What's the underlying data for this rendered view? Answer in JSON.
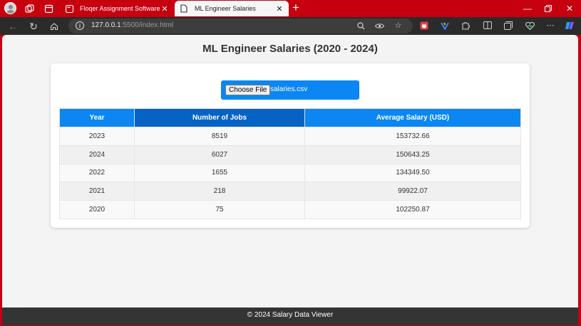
{
  "browser": {
    "tabs": [
      {
        "title": "Floqer Assignment Software Deve"
      },
      {
        "title": "ML Engineer Salaries"
      }
    ],
    "url_host": "127.0.0.1",
    "url_rest": ":5500/index.html"
  },
  "page": {
    "title": "ML Engineer Salaries (2020 - 2024)",
    "file_button_label": "Choose File",
    "file_name": "salaries.csv",
    "table": {
      "headers": [
        "Year",
        "Number of Jobs",
        "Average Salary (USD)"
      ],
      "rows": [
        [
          "2023",
          "8519",
          "153732.66"
        ],
        [
          "2024",
          "6027",
          "150643.25"
        ],
        [
          "2022",
          "1655",
          "134349.50"
        ],
        [
          "2021",
          "218",
          "99922.07"
        ],
        [
          "2020",
          "75",
          "102250.87"
        ]
      ]
    },
    "footer": "© 2024 Salary Data Viewer"
  },
  "colors": {
    "browser_frame": "#c7000f",
    "accent": "#0b86f3",
    "header_hover": "#0663c4",
    "footer_bg": "#343434"
  }
}
